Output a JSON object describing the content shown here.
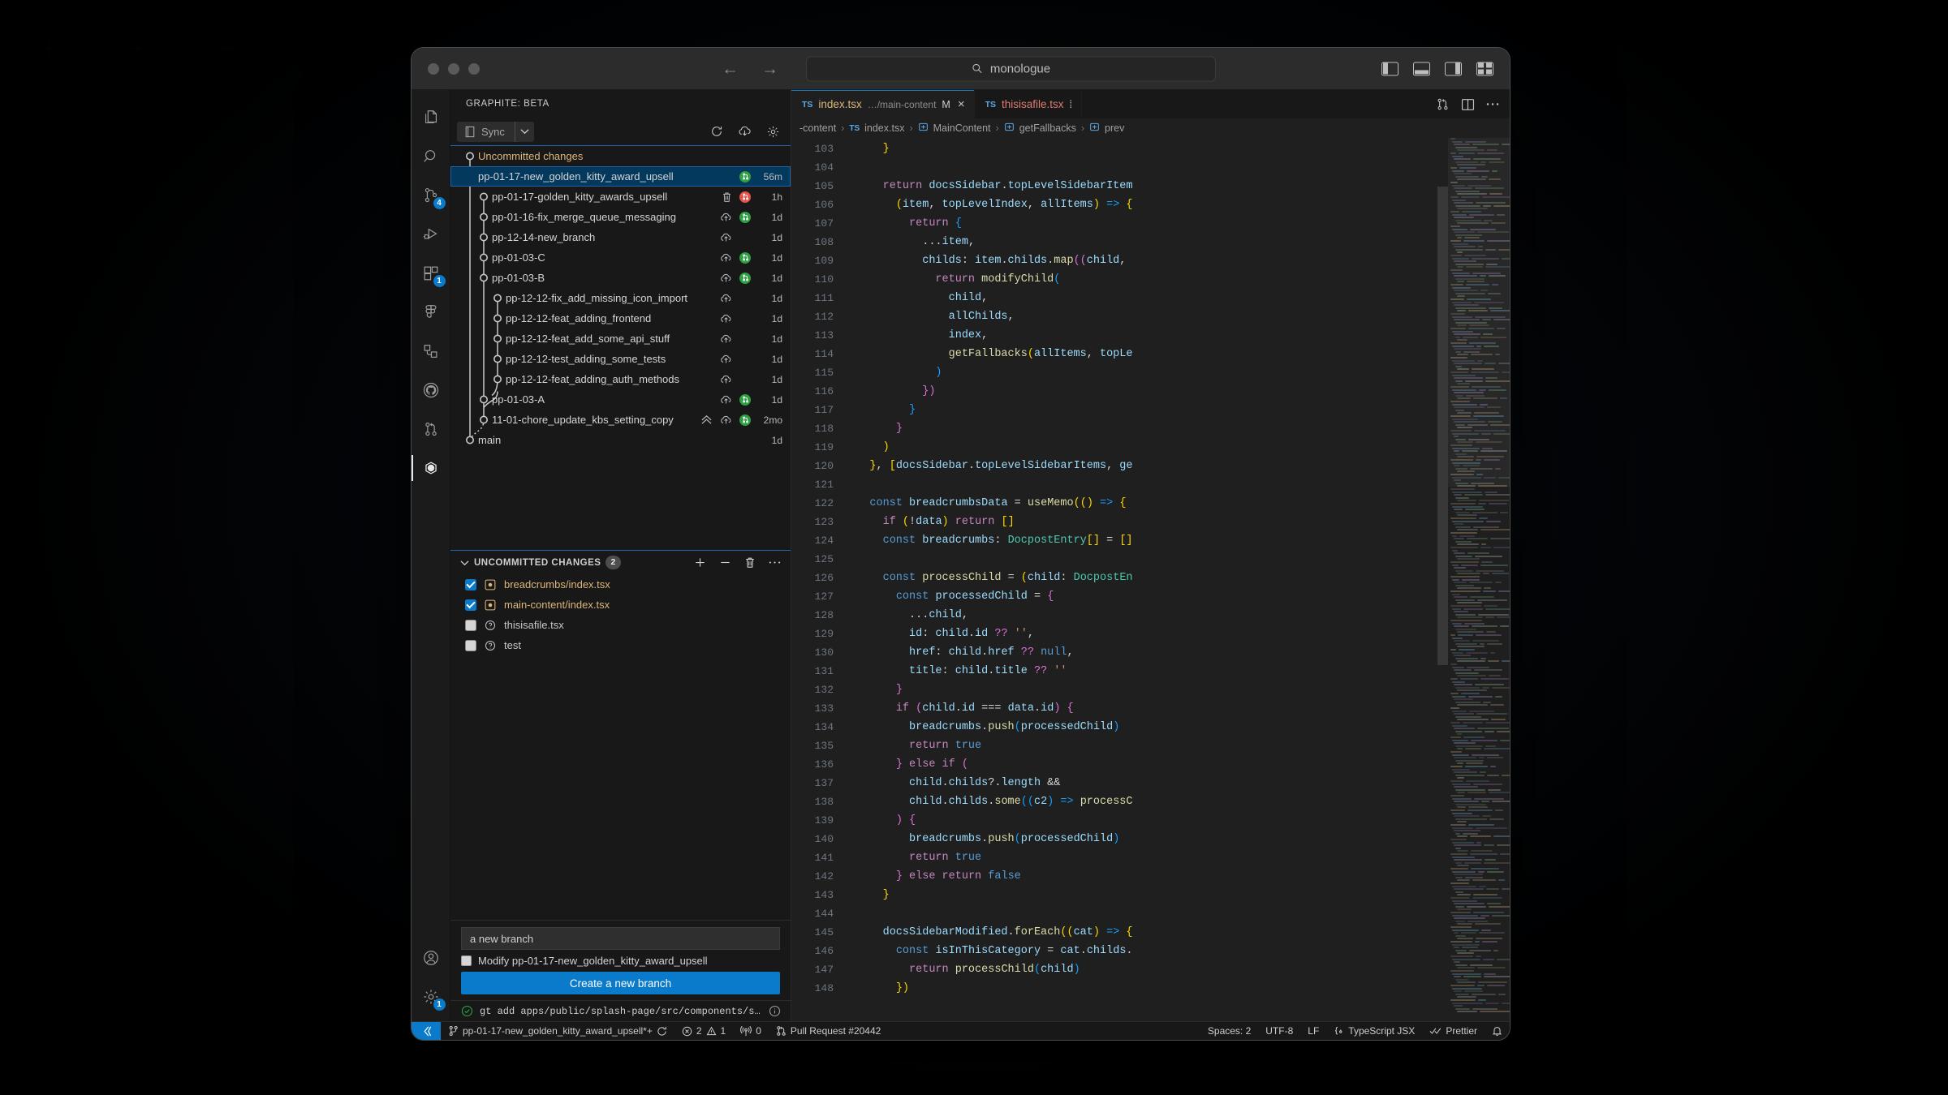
{
  "window": {
    "title_search_value": "monologue",
    "search_icon": "search-icon",
    "nav_back": "←",
    "nav_forward": "→"
  },
  "activity_bar": {
    "items": [
      {
        "name": "explorer",
        "icon": "files-icon",
        "badge": ""
      },
      {
        "name": "search",
        "icon": "search-icon",
        "badge": ""
      },
      {
        "name": "source-control",
        "icon": "source-control-icon",
        "badge": "4"
      },
      {
        "name": "run-and-debug",
        "icon": "run-debug-icon",
        "badge": ""
      },
      {
        "name": "extensions",
        "icon": "extensions-icon",
        "badge": "1"
      },
      {
        "name": "figma",
        "icon": "figma-icon",
        "badge": ""
      },
      {
        "name": "dependencies",
        "icon": "dependency-graph-icon",
        "badge": ""
      },
      {
        "name": "github",
        "icon": "github-icon",
        "badge": ""
      },
      {
        "name": "pull-requests",
        "icon": "pull-request-icon",
        "badge": ""
      },
      {
        "name": "graphite",
        "icon": "graphite-icon",
        "badge": ""
      }
    ],
    "bottom": [
      {
        "name": "accounts",
        "icon": "account-icon"
      },
      {
        "name": "settings",
        "icon": "gear-icon",
        "badge": "1"
      }
    ]
  },
  "sidebar": {
    "view_title": "GRAPHITE: BETA",
    "sync_label": "Sync",
    "sync_icon": "sync-book-icon",
    "sync_dropdown_icon": "chevron-down-icon",
    "toolbar_icons": [
      "refresh-icon",
      "download-cloud-icon",
      "gear-icon"
    ],
    "tree": {
      "uncommitted_label": "Uncommitted changes",
      "branches": [
        {
          "name": "pp-01-17-new_golden_kitty_award_upsell",
          "time": "56m",
          "pr": "green",
          "push": false,
          "trash": false,
          "indent": 0,
          "selected": true
        },
        {
          "name": "pp-01-17-golden_kitty_awards_upsell",
          "time": "1h",
          "pr": "red",
          "push": false,
          "trash": true,
          "indent": 1,
          "selected": false
        },
        {
          "name": "pp-01-16-fix_merge_queue_messaging",
          "time": "1d",
          "pr": "green",
          "push": true,
          "trash": false,
          "indent": 1,
          "selected": false
        },
        {
          "name": "pp-12-14-new_branch",
          "time": "1d",
          "pr": "",
          "push": true,
          "trash": false,
          "indent": 1,
          "selected": false
        },
        {
          "name": "pp-01-03-C",
          "time": "1d",
          "pr": "green",
          "push": true,
          "trash": false,
          "indent": 1,
          "selected": false
        },
        {
          "name": "pp-01-03-B",
          "time": "1d",
          "pr": "green",
          "push": true,
          "trash": false,
          "indent": 1,
          "selected": false
        },
        {
          "name": "pp-12-12-fix_add_missing_icon_import",
          "time": "1d",
          "pr": "",
          "push": true,
          "trash": false,
          "indent": 2,
          "selected": false
        },
        {
          "name": "pp-12-12-feat_adding_frontend",
          "time": "1d",
          "pr": "",
          "push": true,
          "trash": false,
          "indent": 2,
          "selected": false
        },
        {
          "name": "pp-12-12-feat_add_some_api_stuff",
          "time": "1d",
          "pr": "",
          "push": true,
          "trash": false,
          "indent": 2,
          "selected": false
        },
        {
          "name": "pp-12-12-test_adding_some_tests",
          "time": "1d",
          "pr": "",
          "push": true,
          "trash": false,
          "indent": 2,
          "selected": false
        },
        {
          "name": "pp-12-12-feat_adding_auth_methods",
          "time": "1d",
          "pr": "",
          "push": true,
          "trash": false,
          "indent": 2,
          "selected": false
        },
        {
          "name": "pp-01-03-A",
          "time": "1d",
          "pr": "green",
          "push": true,
          "trash": false,
          "indent": 1,
          "selected": false
        },
        {
          "name": "11-01-chore_update_kbs_setting_copy",
          "time": "2mo",
          "pr": "green",
          "push": true,
          "trash": false,
          "collapse": true,
          "indent": 1,
          "selected": false
        },
        {
          "name": "main",
          "time": "1d",
          "pr": "",
          "push": false,
          "trash": false,
          "indent": 0,
          "selected": false
        }
      ]
    },
    "changes": {
      "header": "UNCOMMITTED CHANGES",
      "count": "2",
      "collapse_icon": "chevron-down-icon",
      "actions": [
        "plus-icon",
        "minus-icon",
        "trash-icon",
        "more-icon"
      ],
      "files": [
        {
          "name": "breadcrumbs/index.tsx",
          "checked": true,
          "status": "M",
          "untracked": false
        },
        {
          "name": "main-content/index.tsx",
          "checked": true,
          "status": "M",
          "untracked": false
        },
        {
          "name": "thisisafile.tsx",
          "checked": false,
          "status": "U",
          "untracked": true
        },
        {
          "name": "test",
          "checked": false,
          "status": "U",
          "untracked": true
        }
      ]
    },
    "create": {
      "branch_input_value": "a new branch",
      "modify_checkbox_label": "Modify pp-01-17-new_golden_kitty_award_upsell",
      "modify_checked": false,
      "create_button_label": "Create a new branch"
    },
    "command_line": {
      "status_icon": "check-circle-icon",
      "text": "gt add apps/public/splash-page/src/components/sections/docs/main…",
      "info_icon": "info-icon"
    }
  },
  "editor": {
    "tabs": [
      {
        "lang": "TS",
        "name": "index.tsx",
        "path": "…/main-content",
        "modified": "M",
        "active": true,
        "close": "×"
      },
      {
        "lang": "TS",
        "name": "thisisafile.tsx",
        "path": "",
        "modified": "",
        "active": false,
        "extra": "⁞"
      }
    ],
    "tab_actions": [
      "split-editor-icon",
      "more-actions-icon"
    ],
    "breadcrumbs": [
      "-content",
      "index.tsx",
      "MainContent",
      "getFallbacks",
      "prev"
    ],
    "breadcrumb_sep": "›",
    "first_line_number": 103,
    "lines": [
      {
        "n": 103,
        "html": "      <span class='b1'>}</span>"
      },
      {
        "n": 104,
        "html": ""
      },
      {
        "n": 105,
        "html": "      <span class='k'>return</span> <span class='v'>docsSidebar</span><span class='p'>.</span><span class='v'>topLevelSidebarItem</span>"
      },
      {
        "n": 106,
        "html": "        <span class='b1'>(</span><span class='v'>item</span><span class='p'>, </span><span class='v'>topLevelIndex</span><span class='p'>, </span><span class='v'>allItems</span><span class='b1'>)</span> <span class='b3'>=&gt;</span> <span class='b1'>{</span>"
      },
      {
        "n": 107,
        "html": "          <span class='k'>return</span> <span class='b3'>{</span>"
      },
      {
        "n": 108,
        "html": "            <span class='p'>...</span><span class='v'>item</span><span class='p'>,</span>"
      },
      {
        "n": 109,
        "html": "            <span class='v'>childs</span><span class='p'>: </span><span class='v'>item</span><span class='p'>.</span><span class='v'>childs</span><span class='p'>.</span><span class='f'>map</span><span class='b2'>((</span><span class='v'>child</span><span class='p'>,</span>"
      },
      {
        "n": 110,
        "html": "              <span class='k'>return</span> <span class='f'>modifyChild</span><span class='b3'>(</span>"
      },
      {
        "n": 111,
        "html": "                <span class='v'>child</span><span class='p'>,</span>"
      },
      {
        "n": 112,
        "html": "                <span class='v'>allChilds</span><span class='p'>,</span>"
      },
      {
        "n": 113,
        "html": "                <span class='v'>index</span><span class='p'>,</span>"
      },
      {
        "n": 114,
        "html": "                <span class='f'>getFallbacks</span><span class='b1'>(</span><span class='v'>allItems</span><span class='p'>, </span><span class='v'>topLe</span>"
      },
      {
        "n": 115,
        "html": "              <span class='b3'>)</span>"
      },
      {
        "n": 116,
        "html": "            <span class='b2'>})</span>"
      },
      {
        "n": 117,
        "html": "          <span class='b3'>}</span>"
      },
      {
        "n": 118,
        "html": "        <span class='b2'>}</span>"
      },
      {
        "n": 119,
        "html": "      <span class='b1'>)</span>"
      },
      {
        "n": 120,
        "html": "    <span class='b1'>}</span><span class='p'>, </span><span class='b1'>[</span><span class='v'>docsSidebar</span><span class='p'>.</span><span class='v'>topLevelSidebarItems</span><span class='p'>, </span><span class='v'>ge</span>"
      },
      {
        "n": 121,
        "html": ""
      },
      {
        "n": 122,
        "html": "    <span class='kd'>const</span> <span class='v'>breadcrumbsData</span> <span class='p'>=</span> <span class='f'>useMemo</span><span class='b1'>((</span><span class='b1'>)</span> <span class='b3'>=&gt;</span> <span class='b1'>{</span>"
      },
      {
        "n": 123,
        "html": "      <span class='k'>if</span> <span class='b1'>(</span><span class='p'>!</span><span class='v'>data</span><span class='b1'>)</span> <span class='k'>return</span> <span class='b1'>[]</span>"
      },
      {
        "n": 124,
        "html": "      <span class='kd'>const</span> <span class='v'>breadcrumbs</span><span class='p'>: </span><span class='t'>DocpostEntry</span><span class='b1'>[]</span> <span class='p'>=</span> <span class='b1'>[]</span>"
      },
      {
        "n": 125,
        "html": ""
      },
      {
        "n": 126,
        "html": "      <span class='kd'>const</span> <span class='f'>processChild</span> <span class='p'>=</span> <span class='b1'>(</span><span class='v'>child</span><span class='p'>: </span><span class='t'>DocpostEn</span>"
      },
      {
        "n": 127,
        "html": "        <span class='kd'>const</span> <span class='v'>processedChild</span> <span class='p'>=</span> <span class='b2'>{</span>"
      },
      {
        "n": 128,
        "html": "          <span class='p'>...</span><span class='v'>child</span><span class='p'>,</span>"
      },
      {
        "n": 129,
        "html": "          <span class='v'>id</span><span class='p'>: </span><span class='v'>child</span><span class='p'>.</span><span class='v'>id</span> <span class='b2'>??</span> <span class='s'>''</span><span class='p'>,</span>"
      },
      {
        "n": 130,
        "html": "          <span class='v'>href</span><span class='p'>: </span><span class='v'>child</span><span class='p'>.</span><span class='v'>href</span> <span class='b2'>??</span> <span class='kd'>null</span><span class='p'>,</span>"
      },
      {
        "n": 131,
        "html": "          <span class='v'>title</span><span class='p'>: </span><span class='v'>child</span><span class='p'>.</span><span class='v'>title</span> <span class='b2'>??</span> <span class='s'>''</span>"
      },
      {
        "n": 132,
        "html": "        <span class='b2'>}</span>"
      },
      {
        "n": 133,
        "html": "        <span class='k'>if</span> <span class='b2'>(</span><span class='v'>child</span><span class='p'>.</span><span class='v'>id</span> <span class='p'>===</span> <span class='v'>data</span><span class='p'>.</span><span class='v'>id</span><span class='b2'>)</span> <span class='b2'>{</span>"
      },
      {
        "n": 134,
        "html": "          <span class='v'>breadcrumbs</span><span class='p'>.</span><span class='f'>push</span><span class='b3'>(</span><span class='v'>processedChild</span><span class='b3'>)</span>"
      },
      {
        "n": 135,
        "html": "          <span class='k'>return</span> <span class='kd'>true</span>"
      },
      {
        "n": 136,
        "html": "        <span class='b2'>}</span> <span class='k'>else if</span> <span class='b2'>(</span>"
      },
      {
        "n": 137,
        "html": "          <span class='v'>child</span><span class='p'>.</span><span class='v'>childs</span><span class='p'>?.</span><span class='v'>length</span> <span class='p'>&amp;&amp;</span>"
      },
      {
        "n": 138,
        "html": "          <span class='v'>child</span><span class='p'>.</span><span class='v'>childs</span><span class='p'>.</span><span class='f'>some</span><span class='b3'>((</span><span class='v'>c2</span><span class='b3'>)</span> <span class='b3'>=&gt;</span> <span class='f'>processC</span>"
      },
      {
        "n": 139,
        "html": "        <span class='b2'>)</span> <span class='b2'>{</span>"
      },
      {
        "n": 140,
        "html": "          <span class='v'>breadcrumbs</span><span class='p'>.</span><span class='f'>push</span><span class='b3'>(</span><span class='v'>processedChild</span><span class='b3'>)</span>"
      },
      {
        "n": 141,
        "html": "          <span class='k'>return</span> <span class='kd'>true</span>"
      },
      {
        "n": 142,
        "html": "        <span class='b2'>}</span> <span class='k'>else return</span> <span class='kd'>false</span>"
      },
      {
        "n": 143,
        "html": "      <span class='b1'>}</span>"
      },
      {
        "n": 144,
        "html": ""
      },
      {
        "n": 145,
        "html": "      <span class='v'>docsSidebarModified</span><span class='p'>.</span><span class='f'>forEach</span><span class='b1'>((</span><span class='v'>cat</span><span class='b1'>)</span> <span class='b3'>=&gt;</span> <span class='b1'>{</span>"
      },
      {
        "n": 146,
        "html": "        <span class='kd'>const</span> <span class='v'>isInThisCategory</span> <span class='p'>=</span> <span class='v'>cat</span><span class='p'>.</span><span class='v'>childs</span><span class='p'>.</span>"
      },
      {
        "n": 147,
        "html": "          <span class='k'>return</span> <span class='f'>processChild</span><span class='b3'>(</span><span class='v'>child</span><span class='b3'>)</span>"
      },
      {
        "n": 148,
        "html": "        <span class='b1'>})</span>"
      }
    ]
  },
  "status_bar": {
    "remote_icon": "remote-window-icon",
    "branch_icon": "git-branch-icon",
    "branch": "pp-01-17-new_golden_kitty_award_upsell*+",
    "sync_icon": "sync-icon",
    "errors_icon": "error-icon",
    "errors": "2",
    "warnings_icon": "warning-icon",
    "warnings": "1",
    "ports_icon": "radio-tower-icon",
    "ports": "0",
    "pr_icon": "pull-request-icon",
    "pull_request": "Pull Request #20442",
    "spaces": "Spaces: 2",
    "encoding": "UTF-8",
    "eol": "LF",
    "lang_icon": "braces-icon",
    "language": "TypeScript JSX",
    "formatter_icon": "checkmarks-icon",
    "formatter": "Prettier",
    "bell_icon": "bell-icon"
  },
  "colors": {
    "accent": "#0a7aca",
    "selection": "#04395e",
    "pr_green": "#2ea043",
    "pr_red": "#e5534b",
    "modified_file": "#dcb67a"
  }
}
